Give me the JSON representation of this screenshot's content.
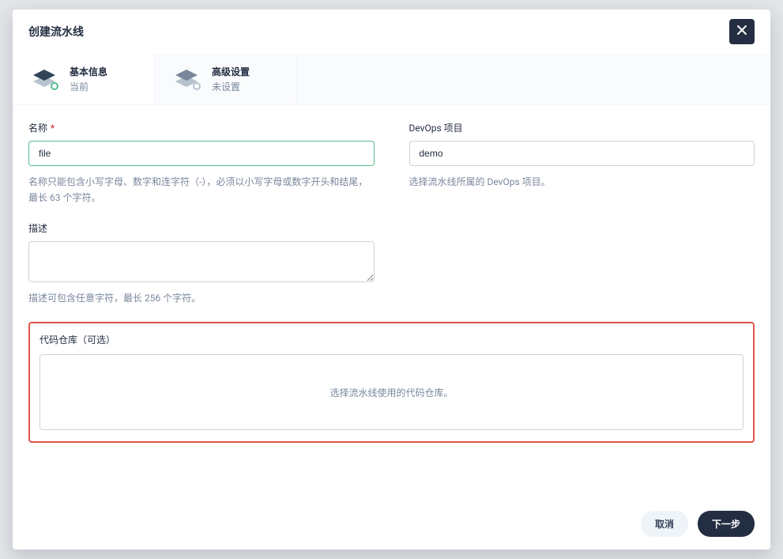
{
  "modal": {
    "title": "创建流水线"
  },
  "tabs": {
    "basic": {
      "title": "基本信息",
      "subtitle": "当前"
    },
    "advanced": {
      "title": "高级设置",
      "subtitle": "未设置"
    }
  },
  "form": {
    "name": {
      "label": "名称",
      "value": "file",
      "hint": "名称只能包含小写字母、数字和连字符（-），必须以小写字母或数字开头和结尾，最长 63 个字符。"
    },
    "project": {
      "label": "DevOps 项目",
      "value": "demo",
      "hint": "选择流水线所属的 DevOps 项目。"
    },
    "description": {
      "label": "描述",
      "value": "",
      "hint": "描述可包含任意字符，最长 256 个字符。"
    },
    "repo": {
      "label": "代码仓库（可选）",
      "placeholder": "选择流水线使用的代码仓库。"
    }
  },
  "footer": {
    "cancel": "取消",
    "next": "下一步"
  }
}
